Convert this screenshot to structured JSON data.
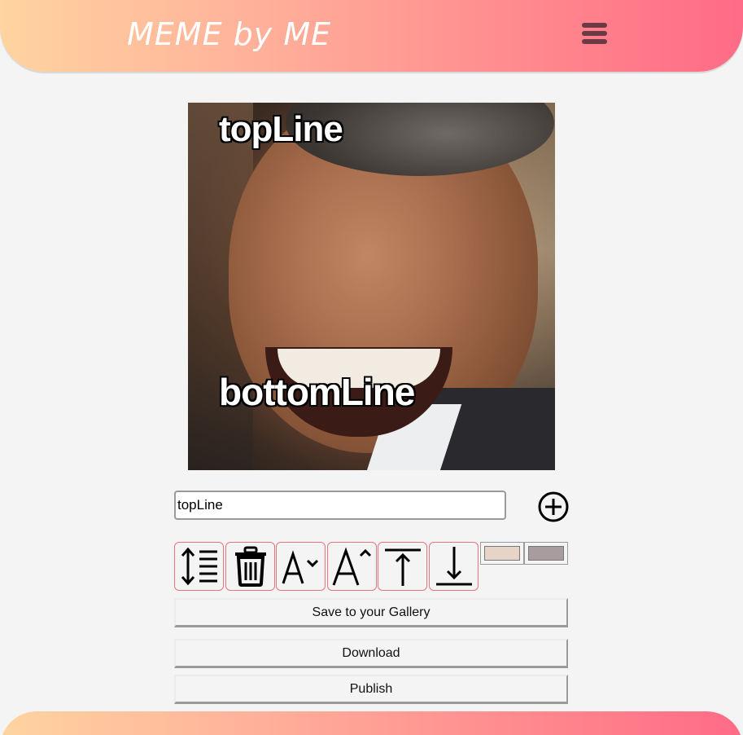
{
  "header": {
    "logo": "MEME by ME",
    "menu_icon": "hamburger-menu-icon"
  },
  "meme": {
    "top_line": "topLine",
    "bottom_line": "bottomLine"
  },
  "editor": {
    "text_input_value": "topLine",
    "add_line_icon": "plus-circle-icon",
    "tools": [
      {
        "name": "switch-line-button",
        "icon": "line-height-icon"
      },
      {
        "name": "delete-line-button",
        "icon": "trash-icon"
      },
      {
        "name": "decrease-font-button",
        "icon": "font-decrease-icon"
      },
      {
        "name": "increase-font-button",
        "icon": "font-increase-icon"
      },
      {
        "name": "move-up-button",
        "icon": "align-top-icon"
      },
      {
        "name": "move-down-button",
        "icon": "align-bottom-icon"
      }
    ],
    "stroke_color": "#e6d4c8",
    "fill_color": "#a89c9e"
  },
  "actions": {
    "save_label": "Save to your Gallery",
    "download_label": "Download",
    "publish_label": "Publish"
  },
  "colors": {
    "accent": "#e8747e",
    "gradient_start": "#ffd4a0",
    "gradient_end": "#ff6b86"
  }
}
